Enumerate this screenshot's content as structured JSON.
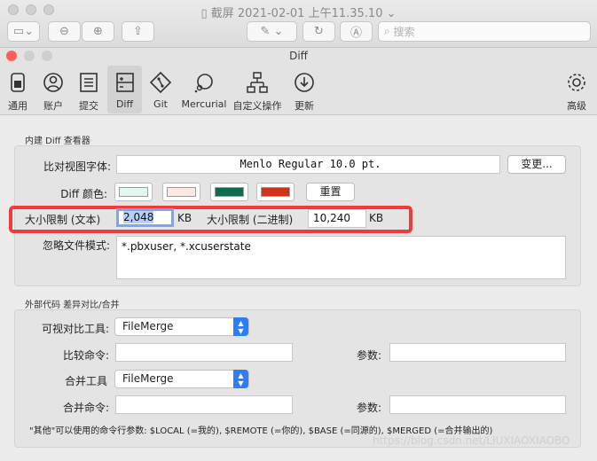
{
  "outer_window": {
    "title": "截屏 2021-02-01 上午11.35.10",
    "search_placeholder": "搜索"
  },
  "window": {
    "title": "Diff"
  },
  "toolbar": {
    "items": [
      {
        "label": "通用",
        "icon": "general-icon"
      },
      {
        "label": "账户",
        "icon": "accounts-icon"
      },
      {
        "label": "提交",
        "icon": "commit-icon"
      },
      {
        "label": "Diff",
        "icon": "diff-icon",
        "active": true
      },
      {
        "label": "Git",
        "icon": "git-icon"
      },
      {
        "label": "Mercurial",
        "icon": "mercurial-icon"
      },
      {
        "label": "自定义操作",
        "icon": "custom-actions-icon"
      },
      {
        "label": "更新",
        "icon": "update-icon"
      },
      {
        "label": "高级",
        "icon": "gear-icon"
      }
    ]
  },
  "builtin": {
    "group_title": "内建 Diff 查看器",
    "font_label": "比对视图字体:",
    "font_value": "Menlo Regular 10.0 pt.",
    "change_button": "变更...",
    "colors_label": "Diff 颜色:",
    "colors": [
      "#e3f7ee",
      "#fbe8e3",
      "#0f6b50",
      "#d2341b"
    ],
    "reset_button": "重置",
    "size_text_label": "大小限制 (文本)",
    "size_text_value": "2,048",
    "size_text_unit": "KB",
    "size_binary_label": "大小限制 (二进制)",
    "size_binary_value": "10,240",
    "size_binary_unit": "KB",
    "ignore_label": "忽略文件模式:",
    "ignore_value": "*.pbxuser, *.xcuserstate"
  },
  "external": {
    "group_title": "外部代码 差异对比/合并",
    "visual_tool_label": "可视对比工具:",
    "visual_tool_value": "FileMerge",
    "compare_cmd_label": "比较命令:",
    "compare_args_label": "参数:",
    "merge_tool_label": "合并工具",
    "merge_tool_value": "FileMerge",
    "merge_cmd_label": "合并命令:",
    "merge_args_label": "参数:",
    "hint": "\"其他\"可以使用的命令行参数: $LOCAL (=我的), $REMOTE (=你的), $BASE (=同源的), $MERGED (=合并输出的)"
  },
  "watermark": "https://blog.csdn.net/LIUXIAOXIAOBO"
}
